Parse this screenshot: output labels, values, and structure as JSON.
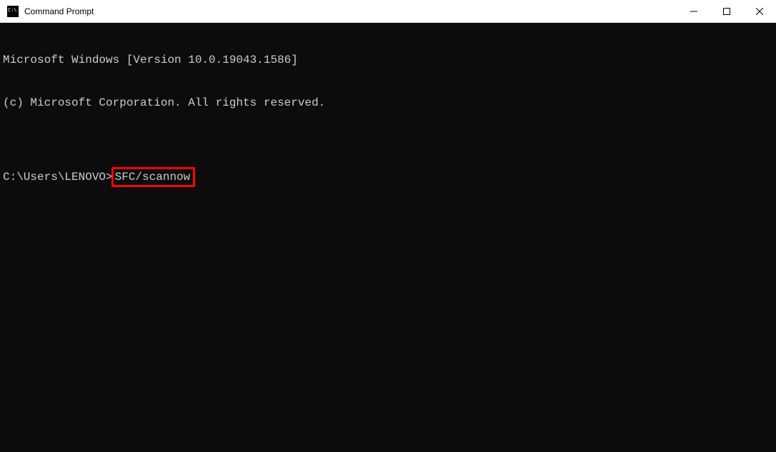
{
  "window": {
    "title": "Command Prompt"
  },
  "terminal": {
    "line1": "Microsoft Windows [Version 10.0.19043.1586]",
    "line2": "(c) Microsoft Corporation. All rights reserved.",
    "blank": "",
    "prompt": "C:\\Users\\LENOVO>",
    "command": "SFC/scannow"
  },
  "highlight": {
    "color": "#ff0000"
  }
}
